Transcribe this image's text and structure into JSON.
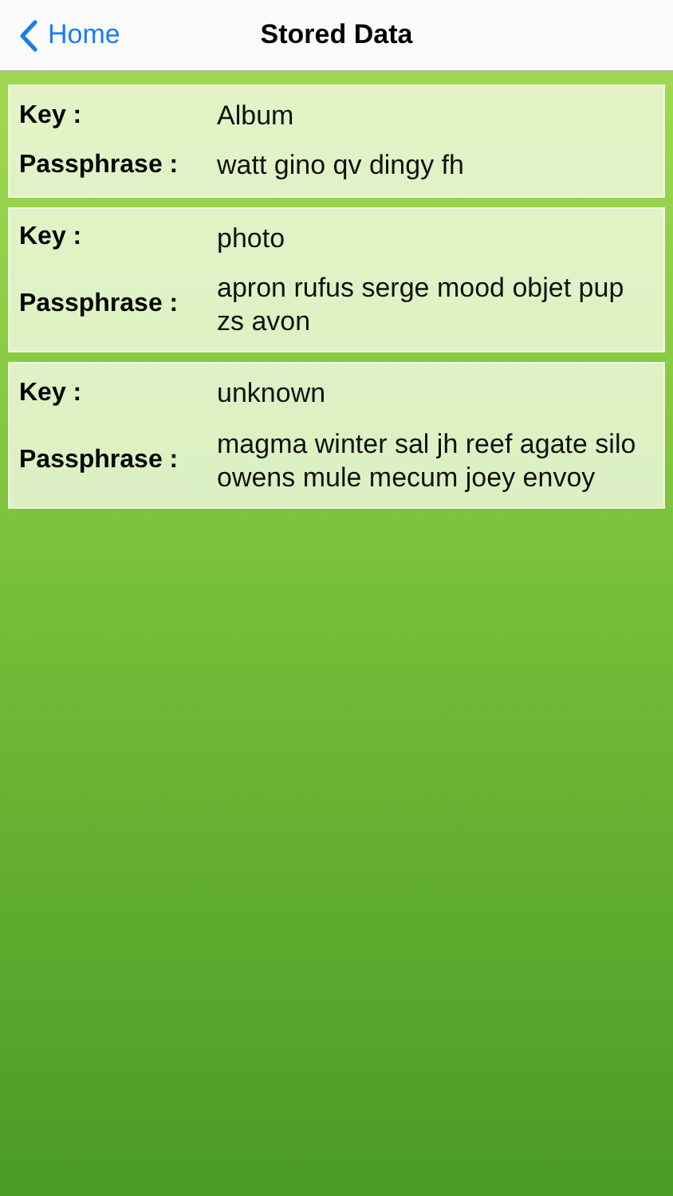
{
  "nav_bar": {
    "back_label": "Home",
    "title": "Stored Data"
  },
  "entries": [
    {
      "key_label": "Key :",
      "key": "Album",
      "passphrase_label": "Passphrase :",
      "passphrase": "watt gino qv dingy fh"
    },
    {
      "key_label": "Key :",
      "key": "photo",
      "passphrase_label": "Passphrase :",
      "passphrase": "apron rufus serge mood objet pup zs avon"
    },
    {
      "key_label": "Key :",
      "key": "unknown",
      "passphrase_label": "Passphrase :",
      "passphrase": "magma winter sal jh reef agate silo owens mule mecum joey envoy"
    }
  ]
}
